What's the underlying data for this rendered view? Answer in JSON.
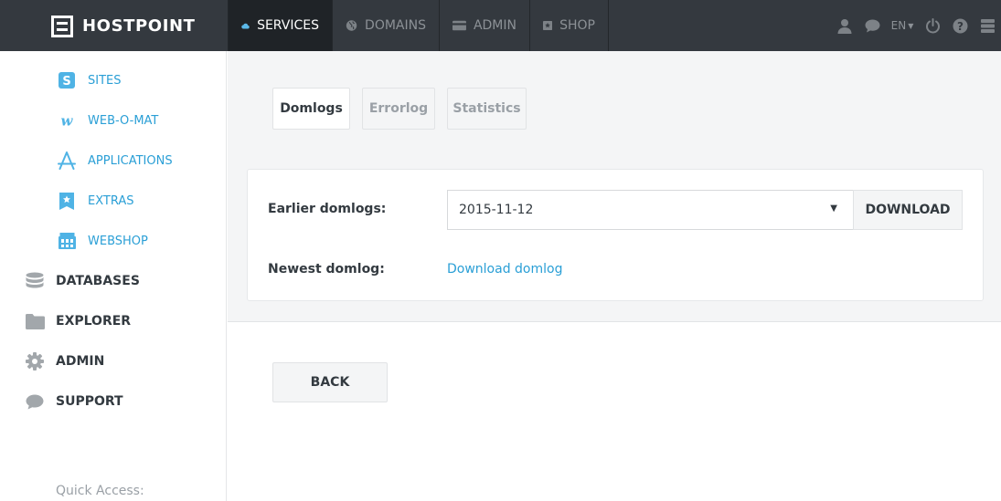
{
  "brand": {
    "name": "HOSTPOINT"
  },
  "nav": {
    "items": [
      {
        "label": "SERVICES",
        "icon": "cloud-icon",
        "active": true
      },
      {
        "label": "DOMAINS",
        "icon": "globe-icon",
        "active": false
      },
      {
        "label": "ADMIN",
        "icon": "credit-card-icon",
        "active": false
      },
      {
        "label": "SHOP",
        "icon": "star-box-icon",
        "active": false
      }
    ]
  },
  "topbar": {
    "language": "EN",
    "icons": [
      "user-icon",
      "chat-icon",
      "power-icon",
      "help-icon",
      "server-icon"
    ]
  },
  "sidebar": {
    "sub_items": [
      {
        "label": "SITES",
        "icon": "sites-icon"
      },
      {
        "label": "WEB-O-MAT",
        "icon": "web-o-mat-icon"
      },
      {
        "label": "APPLICATIONS",
        "icon": "applications-icon"
      },
      {
        "label": "EXTRAS",
        "icon": "extras-icon"
      },
      {
        "label": "WEBSHOP",
        "icon": "webshop-icon"
      }
    ],
    "main_items": [
      {
        "label": "DATABASES",
        "icon": "database-icon"
      },
      {
        "label": "EXPLORER",
        "icon": "folder-icon"
      },
      {
        "label": "ADMIN",
        "icon": "gear-icon"
      },
      {
        "label": "SUPPORT",
        "icon": "chat-icon"
      }
    ],
    "quick_access": "Quick Access:"
  },
  "tabs": [
    {
      "label": "Domlogs",
      "active": true
    },
    {
      "label": "Errorlog",
      "active": false
    },
    {
      "label": "Statistics",
      "active": false
    }
  ],
  "form": {
    "earlier_label": "Earlier domlogs:",
    "selected_date": "2015-11-12",
    "download_button": "DOWNLOAD",
    "newest_label": "Newest domlog:",
    "newest_link": "Download domlog"
  },
  "back_button": "BACK",
  "colors": {
    "topbar": "#34393f",
    "accent": "#2a9fd6",
    "panel_bg": "#f4f5f6"
  }
}
